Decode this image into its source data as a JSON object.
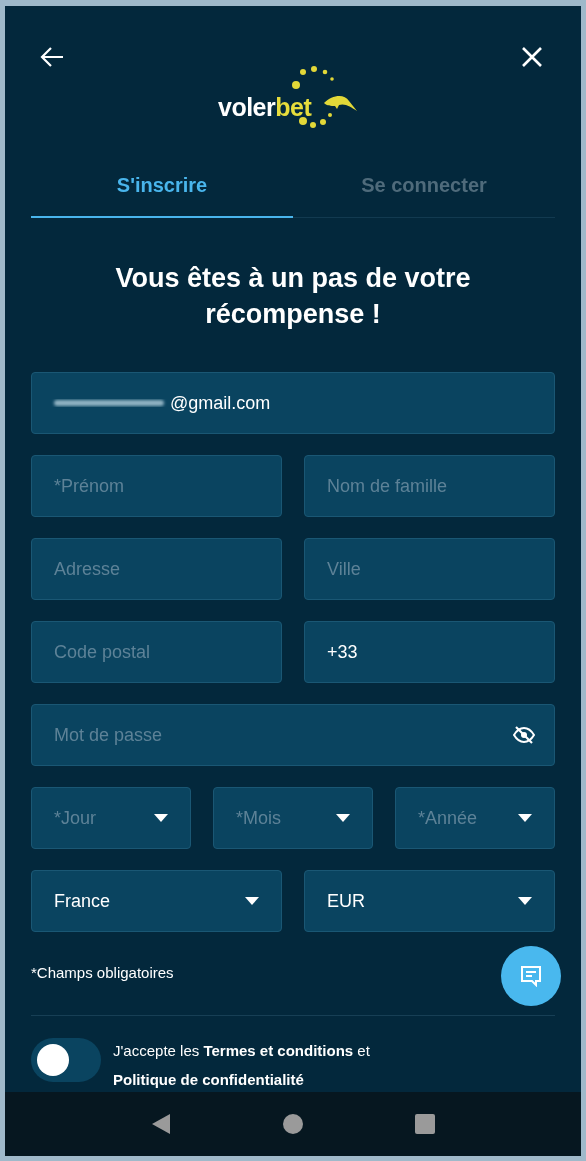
{
  "header": {
    "logo": {
      "part_a": "voler",
      "part_b": "bet"
    }
  },
  "tabs": [
    {
      "label": "S'inscrire",
      "selected": true
    },
    {
      "label": "Se connecter",
      "selected": false
    }
  ],
  "heading": "Vous êtes à un pas de votre récompense !",
  "form": {
    "rows": [
      [
        {
          "kind": "text",
          "value": "@gmail.com",
          "redacted": true
        }
      ],
      [
        {
          "kind": "text",
          "placeholder": "*Prénom"
        },
        {
          "kind": "text",
          "placeholder": "Nom de famille"
        }
      ],
      [
        {
          "kind": "text",
          "placeholder": "Adresse"
        },
        {
          "kind": "text",
          "placeholder": "Ville"
        }
      ],
      [
        {
          "kind": "text",
          "placeholder": "Code postal"
        },
        {
          "kind": "text",
          "value": "+33"
        }
      ],
      [
        {
          "kind": "password",
          "placeholder": "Mot de passe"
        }
      ],
      [
        {
          "kind": "select",
          "placeholder": "*Jour"
        },
        {
          "kind": "select",
          "placeholder": "*Mois"
        },
        {
          "kind": "select",
          "placeholder": "*Année"
        }
      ],
      [
        {
          "kind": "select",
          "value": "France"
        },
        {
          "kind": "select",
          "value": "EUR"
        }
      ]
    ],
    "required_note": "*Champs obligatoires"
  },
  "consent": {
    "checked": false,
    "text": "J'accepte les **Termes et conditions** et **Politique de confidentialité**"
  }
}
